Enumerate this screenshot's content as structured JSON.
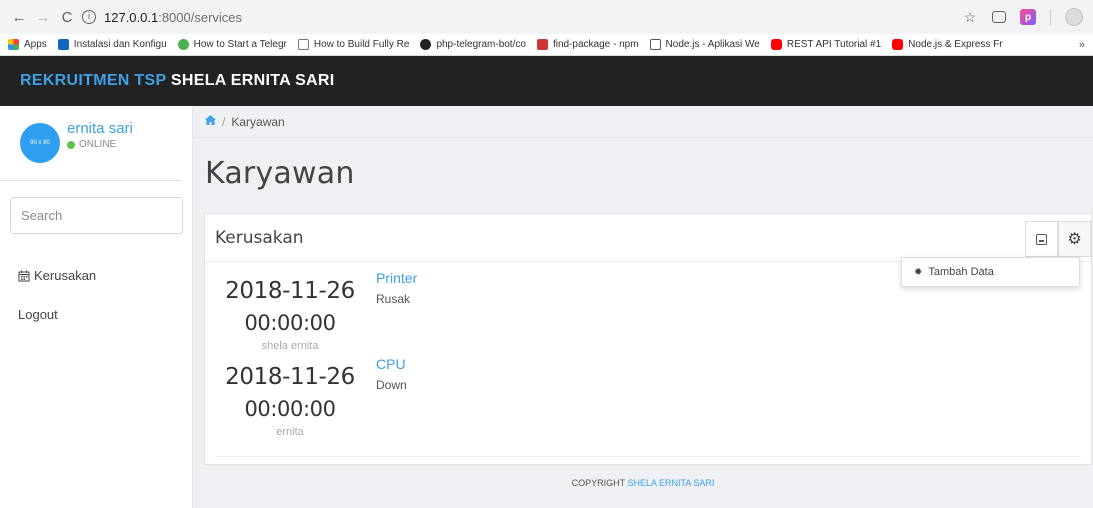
{
  "browser": {
    "host": "127.0.0.1",
    "path": ":8000/services",
    "bookmarks": [
      {
        "label": "Apps",
        "color": "#f44336"
      },
      {
        "label": "Instalasi dan Konfigu",
        "color": "#1565c0"
      },
      {
        "label": "How to Start a Telegr",
        "color": "#4caf50"
      },
      {
        "label": "How to Build Fully Re",
        "color": "#777777"
      },
      {
        "label": "php-telegram-bot/co",
        "color": "#222222"
      },
      {
        "label": "find-package - npm",
        "color": "#cb3837"
      },
      {
        "label": "Node.js - Aplikasi We",
        "color": "#555555"
      },
      {
        "label": "REST API Tutorial #1",
        "color": "#ff0000"
      },
      {
        "label": "Node.js & Express Fr",
        "color": "#ff0000"
      }
    ]
  },
  "header": {
    "brand_accent": "REKRUITMEN TSP",
    "brand_name": "SHELA ERNITA SARI"
  },
  "sidebar": {
    "user_name": "ernita sari",
    "user_status": "ONLINE",
    "avatar_text": "90 x 90",
    "search_placeholder": "Search",
    "items": [
      {
        "label": "Kerusakan",
        "icon": "calendar-icon"
      },
      {
        "label": "Logout"
      }
    ]
  },
  "main": {
    "breadcrumb": "Karyawan",
    "page_title": "Karyawan",
    "card_title": "Kerusakan",
    "dropdown_item": "Tambah Data",
    "entries": [
      {
        "date": "2018-11-26",
        "time": "00:00:00",
        "user": "shela ernita",
        "device": "Printer",
        "status": "Rusak"
      },
      {
        "date": "2018-11-26",
        "time": "00:00:00",
        "user": "ernita",
        "device": "CPU",
        "status": "Down"
      }
    ]
  },
  "footer": {
    "prefix": "COPYRIGHT",
    "name": "SHELA ERNITA SARI"
  },
  "colors": {
    "accent": "#3ea0e6",
    "header_bg": "#222222",
    "online": "#5fc34d"
  }
}
